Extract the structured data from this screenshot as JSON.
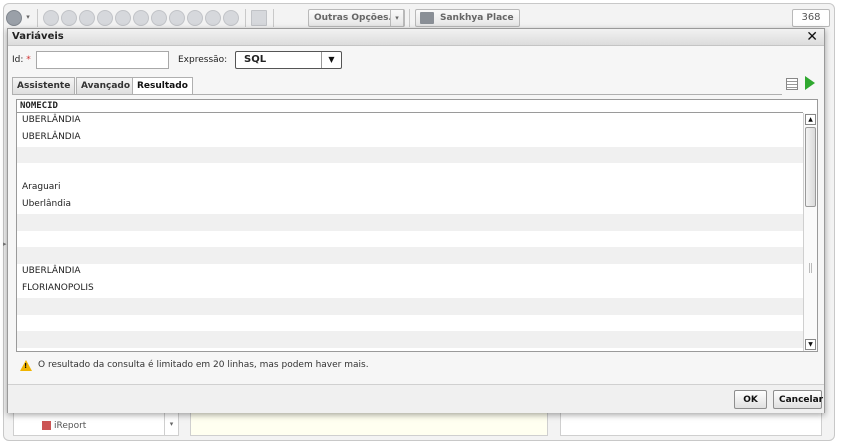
{
  "toolbar": {
    "outras_opcoes_label": "Outras Opções...",
    "sankhya_place_label": "Sankhya Place",
    "record_count": "368"
  },
  "background": {
    "ireport_label": "iReport"
  },
  "dialog": {
    "title": "Variáveis",
    "id_label": "Id:",
    "id_required_mark": "*",
    "id_value": "",
    "expressao_label": "Expressão:",
    "expressao_value": "SQL",
    "tabs": [
      {
        "label": "Assistente",
        "active": false
      },
      {
        "label": "Avançado",
        "active": false
      },
      {
        "label": "Resultado",
        "active": true
      }
    ],
    "grid": {
      "column_header": "NOMECID",
      "rows": [
        "UBERLÂNDIA",
        "UBERLÂNDIA",
        "",
        "",
        "Araguari",
        "Uberlândia",
        "",
        "",
        "",
        "UBERLÂNDIA",
        "FLORIANOPOLIS",
        "",
        "",
        ""
      ]
    },
    "warning_text": "O resultado da consulta é limitado em 20 linhas, mas podem haver mais.",
    "ok_label": "OK",
    "cancel_label": "Cancelar"
  }
}
